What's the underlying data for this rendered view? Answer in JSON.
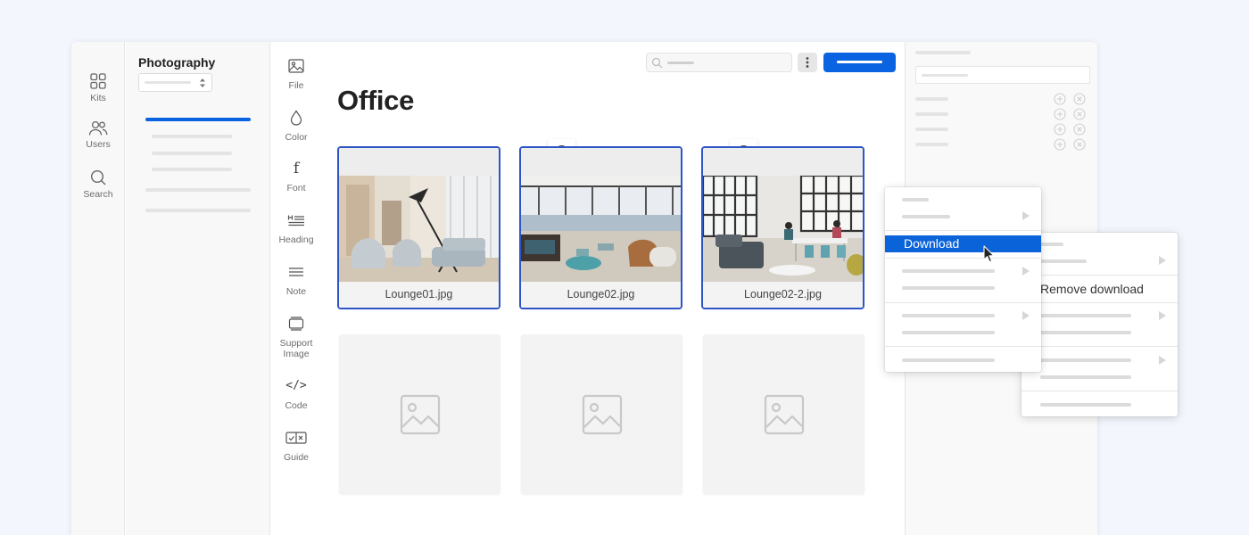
{
  "window": {
    "traffic_lights": [
      "#fe5f57",
      "#febc2e",
      "#28c840"
    ]
  },
  "rail": {
    "items": [
      {
        "label": "Kits",
        "icon": "grid-icon"
      },
      {
        "label": "Users",
        "icon": "users-icon"
      },
      {
        "label": "Search",
        "icon": "search-icon"
      }
    ]
  },
  "kit_panel": {
    "title": "Photography",
    "accent": "#0a63e0"
  },
  "tools": {
    "items": [
      {
        "label": "File",
        "icon": "image-file-icon"
      },
      {
        "label": "Color",
        "icon": "color-drop-icon"
      },
      {
        "label": "Font",
        "icon": "font-icon"
      },
      {
        "label": "Heading",
        "icon": "heading-icon"
      },
      {
        "label": "Note",
        "icon": "note-icon"
      },
      {
        "label": "Support Image",
        "icon": "support-image-icon"
      },
      {
        "label": "Code",
        "icon": "code-icon"
      },
      {
        "label": "Guide",
        "icon": "guide-icon"
      }
    ]
  },
  "main": {
    "title": "Office",
    "assets": [
      {
        "filename": "Lounge01.jpg",
        "icon": "cloud-download-icon"
      },
      {
        "filename": "Lounge02.jpg",
        "icon": "cloud-download-icon"
      },
      {
        "filename": "Lounge02-2.jpg",
        "icon": "cloud-download-icon"
      }
    ],
    "selection_color": "#2e55c6"
  },
  "context_menu": {
    "highlighted_item": "Download",
    "highlight_color": "#0a63d8"
  },
  "submenu": {
    "item": "Remove download"
  }
}
